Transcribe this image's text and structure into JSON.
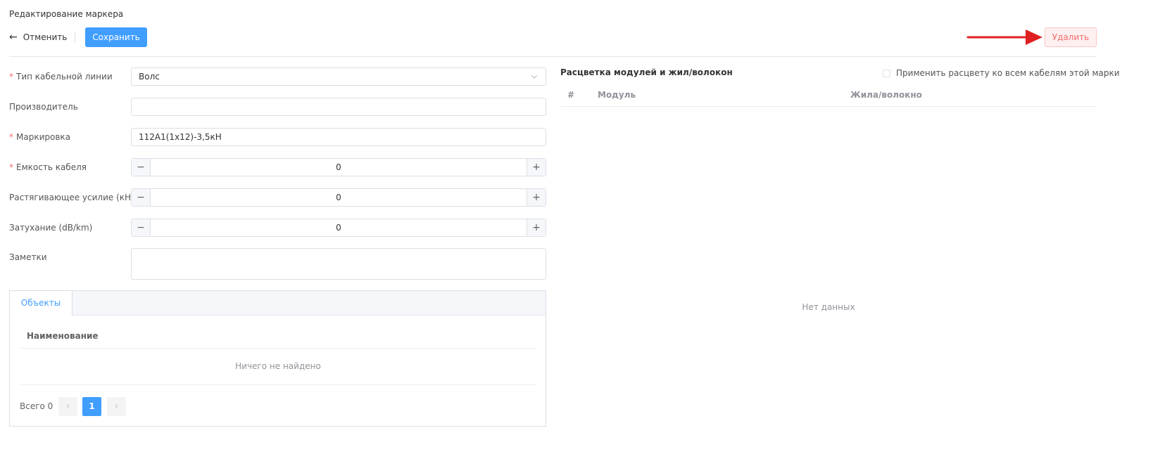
{
  "page_title": "Редактирование маркера",
  "toolbar": {
    "cancel_label": "Отменить",
    "save_label": "Сохранить",
    "delete_label": "Удалить"
  },
  "form": {
    "cable_type": {
      "label": "Тип кабельной линии",
      "value": "Волс",
      "required": true
    },
    "manufacturer": {
      "label": "Производитель",
      "value": ""
    },
    "marking": {
      "label": "Маркировка",
      "value": "112А1(1х12)-3,5кН",
      "required": true
    },
    "capacity": {
      "label": "Емкость кабеля",
      "value": "0",
      "required": true
    },
    "tensile": {
      "label": "Растягивающее усилие (кН)",
      "value": "0"
    },
    "attenuation": {
      "label": "Затухание (dB/km)",
      "value": "0"
    },
    "notes": {
      "label": "Заметки",
      "value": ""
    }
  },
  "objects": {
    "tab_label": "Объекты",
    "column_name": "Наименование",
    "empty_text": "Ничего не найдено",
    "total_label": "Всего 0",
    "current_page": "1"
  },
  "coloring": {
    "title": "Расцветка модулей и жил/волокон",
    "apply_all_label": "Применить расцвету ко всем кабелям этой марки",
    "columns": {
      "hash": "#",
      "module": "Модуль",
      "fiber": "Жила/волокно"
    },
    "no_data": "Нет данных"
  },
  "colors": {
    "primary": "#409eff",
    "danger": "#f56c6c",
    "annotation_arrow": "#e02020"
  }
}
